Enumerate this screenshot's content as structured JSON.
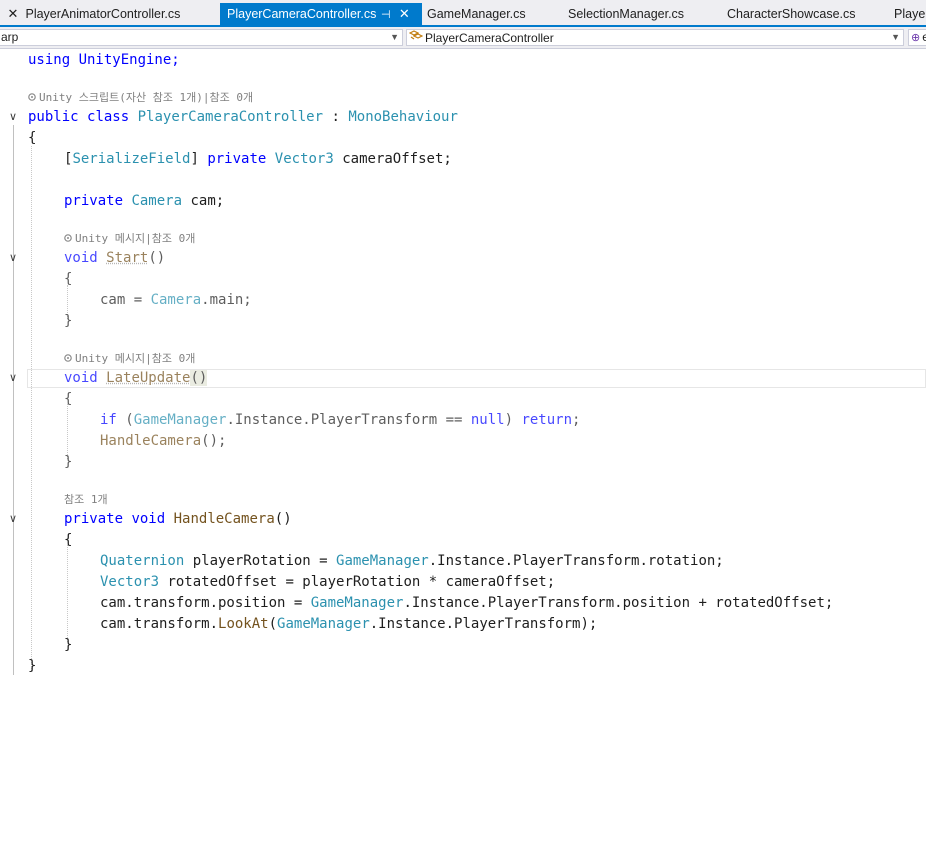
{
  "tabs": [
    {
      "label": "PlayerAnimatorController.cs",
      "active": false,
      "close": "✕"
    },
    {
      "label": "PlayerCameraController.cs",
      "active": true,
      "pin": "⊣",
      "close": "✕"
    },
    {
      "label": "GameManager.cs",
      "active": false
    },
    {
      "label": "SelectionManager.cs",
      "active": false
    },
    {
      "label": "CharacterShowcase.cs",
      "active": false
    },
    {
      "label": "Player",
      "active": false
    }
  ],
  "navbar": {
    "project_combo": "arp",
    "class_combo": "PlayerCameraController",
    "member_combo": "e"
  },
  "code": {
    "line1": "using UnityEngine;",
    "lens_class": "Unity 스크립트(자산 참조 1개)|참조 0개",
    "class_decl": {
      "kw1": "public",
      "kw2": "class",
      "name": "PlayerCameraController",
      "colon": " : ",
      "base": "MonoBehaviour"
    },
    "open_brace": "{",
    "field1": {
      "open": "[",
      "attr": "SerializeField",
      "close": "]",
      "kw": "private",
      "type": "Vector3",
      "rest": " cameraOffset;"
    },
    "field2": {
      "kw": "private",
      "type": "Camera",
      "rest": " cam;"
    },
    "lens_start": "Unity 메시지|참조 0개",
    "start_decl": {
      "kw": "void",
      "name": "Start",
      "parens": "()"
    },
    "start_body": {
      "lhs": "cam = ",
      "type": "Camera",
      "rest": ".main;"
    },
    "lens_late": "Unity 메시지|참조 0개",
    "late_decl": {
      "kw": "void",
      "name": "LateUpdate",
      "parens": "()"
    },
    "late_if": {
      "kw": "if",
      "open": " (",
      "type": "GameManager",
      "mid": ".Instance.PlayerTransform == ",
      "null": "null",
      "close": ") ",
      "ret": "return",
      "semi": ";"
    },
    "late_call": {
      "name": "HandleCamera",
      "rest": "();"
    },
    "lens_handle": "참조 1개",
    "handle_decl": {
      "kw1": "private",
      "kw2": "void",
      "name": "HandleCamera",
      "parens": "()"
    },
    "h1": {
      "type": "Quaternion",
      "a": " playerRotation = ",
      "type2": "GameManager",
      "b": ".Instance.PlayerTransform.rotation;"
    },
    "h2": {
      "type": "Vector3",
      "a": " rotatedOffset = playerRotation * cameraOffset;"
    },
    "h3": {
      "a": "cam.transform.position = ",
      "type": "GameManager",
      "b": ".Instance.PlayerTransform.position + rotatedOffset;"
    },
    "h4": {
      "a": "cam.transform.",
      "fn": "LookAt",
      "b": "(",
      "type": "GameManager",
      "c": ".Instance.PlayerTransform);"
    },
    "close_brace": "}",
    "fold_glyph": "∨"
  },
  "colors": {
    "keyword": "#0000ff",
    "type": "#2b91af",
    "method": "#74531f",
    "accent": "#007acc",
    "lens": "#808080"
  }
}
